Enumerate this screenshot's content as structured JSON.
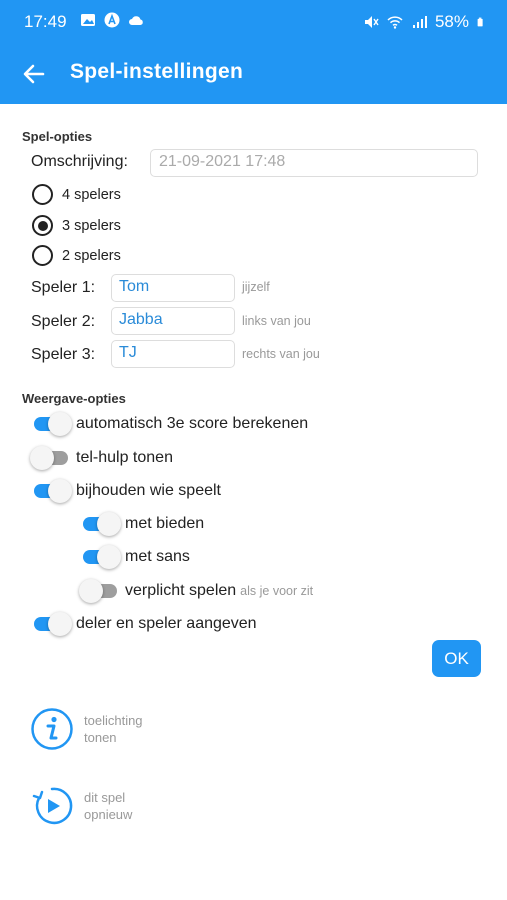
{
  "status": {
    "time": "17:49",
    "battery": "58%"
  },
  "header": {
    "title": "Spel-instellingen"
  },
  "game_options": {
    "section_title": "Spel-opties",
    "description_label": "Omschrijving:",
    "description_value": "21-09-2021 17:48",
    "radio_options": [
      {
        "label": "4 spelers",
        "checked": false
      },
      {
        "label": "3 spelers",
        "checked": true
      },
      {
        "label": "2 spelers",
        "checked": false
      }
    ],
    "players": [
      {
        "label": "Speler 1:",
        "name": "Tom",
        "hint": "jijzelf"
      },
      {
        "label": "Speler 2:",
        "name": "Jabba",
        "hint": "links van jou"
      },
      {
        "label": "Speler 3:",
        "name": "TJ",
        "hint": "rechts van jou"
      }
    ]
  },
  "display_options": {
    "section_title": "Weergave-opties",
    "toggles": [
      {
        "label": "automatisch 3e score berekenen",
        "on": true
      },
      {
        "label": "tel-hulp tonen",
        "on": false
      },
      {
        "label": "bijhouden wie speelt",
        "on": true
      },
      {
        "label": "met bieden",
        "on": true
      },
      {
        "label": "met sans",
        "on": true
      },
      {
        "label": "verplicht spelen",
        "hint": "als je voor zit",
        "on": false
      },
      {
        "label": "deler en speler aangeven",
        "on": true
      }
    ]
  },
  "ok_label": "OK",
  "actions": {
    "info": {
      "line1": "toelichting",
      "line2": "tonen"
    },
    "restart": {
      "line1": "dit spel",
      "line2": "opnieuw"
    }
  },
  "colors": {
    "primary": "#2196f3",
    "input_text": "#2a8bd8",
    "hint": "#999999"
  }
}
